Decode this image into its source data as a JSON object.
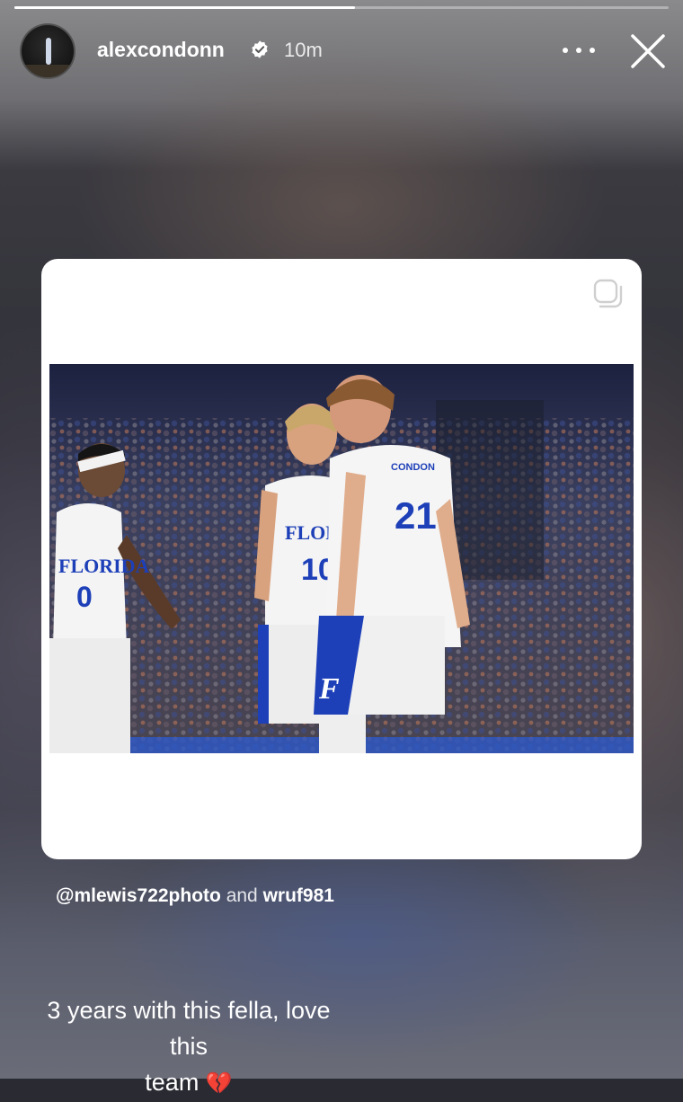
{
  "story": {
    "progress": 0.52,
    "username": "alexcondonn",
    "verified": true,
    "time_ago": "10m"
  },
  "icons": {
    "verified": "verified-badge-icon",
    "more": "more-options-icon",
    "close": "close-icon",
    "shared_post": "shared-post-icon"
  },
  "shared_post": {
    "image_alt": "Florida basketball players 0, 10 and 21 Condon celebrating on court",
    "jersey_text": "FLORIDA",
    "jersey_numbers": [
      "0",
      "10",
      "21"
    ],
    "player_name_on_jersey": "CONDON"
  },
  "tags": {
    "first": "@mlewis722photo",
    "connector": "and",
    "second": "wruf981"
  },
  "caption": {
    "line1": "3 years with this fella, love this",
    "line2": "team",
    "emoji": "💔"
  },
  "colors": {
    "gator_blue": "#1d3fb8",
    "gator_orange": "#e8692b",
    "jersey_white": "#f4f4f4"
  }
}
